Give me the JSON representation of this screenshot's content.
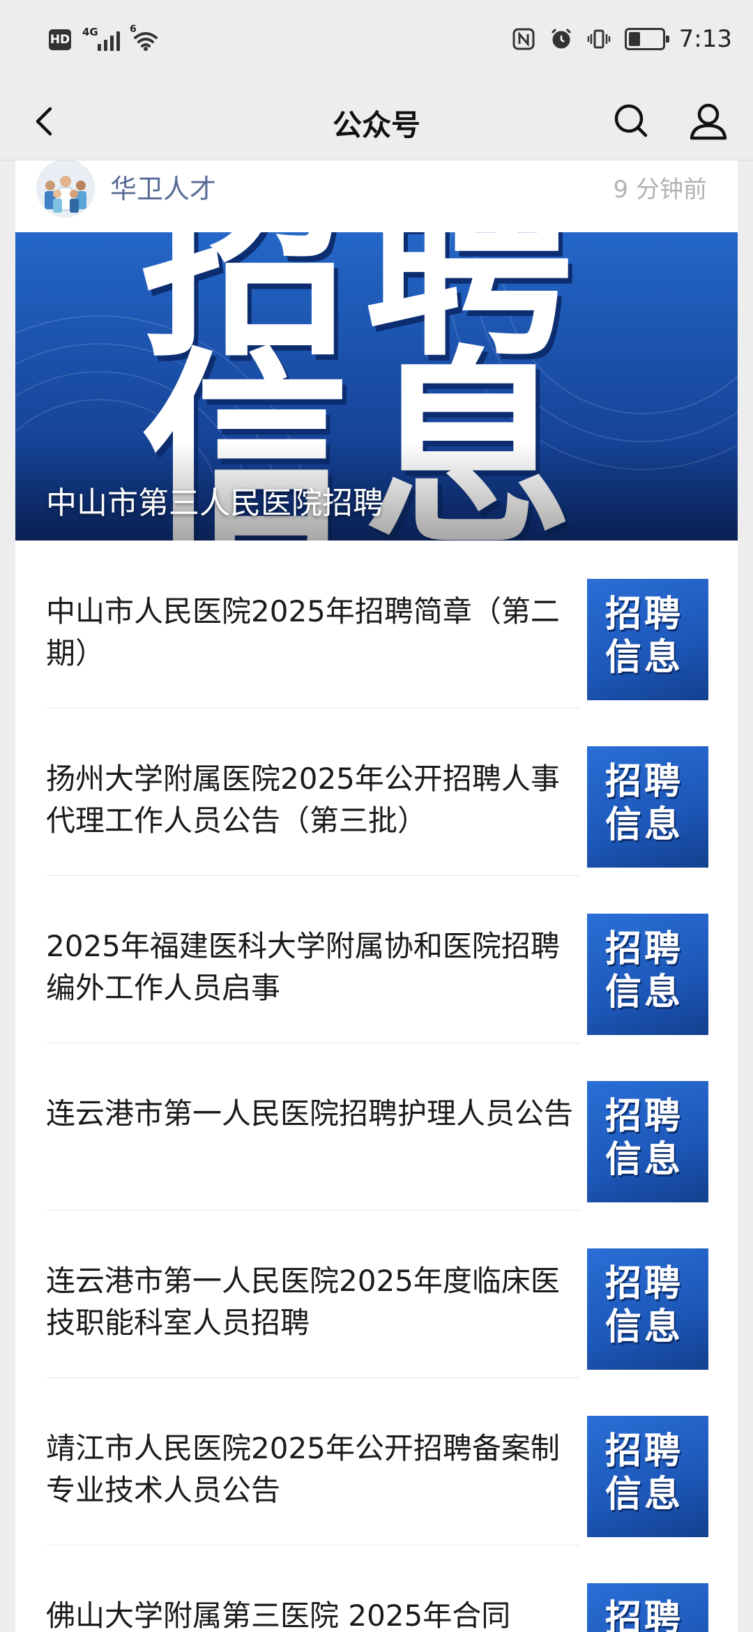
{
  "status_bar": {
    "hd": "HD",
    "network": "4G",
    "wifi_badge": "6",
    "time": "7:13",
    "battery_level": 0.35
  },
  "nav": {
    "title": "公众号",
    "back_icon": "chevron-left-icon",
    "search_icon": "search-icon",
    "profile_icon": "person-icon"
  },
  "post": {
    "account_name": "华卫人才",
    "time": "9 分钟前",
    "hero_caption": "中山市第三人民医院招聘",
    "hero_bg_text": "招聘信息"
  },
  "articles": [
    {
      "title": "中山市人民医院2025年招聘简章（第二期）",
      "thumb_text": "招聘信息"
    },
    {
      "title": "扬州大学附属医院2025年公开招聘人事代理工作人员公告（第三批）",
      "thumb_text": "招聘信息"
    },
    {
      "title": "2025年福建医科大学附属协和医院招聘编外工作人员启事",
      "thumb_text": "招聘信息"
    },
    {
      "title": "连云港市第一人民医院招聘护理人员公告",
      "thumb_text": "招聘信息"
    },
    {
      "title": "连云港市第一人民医院2025年度临床医技职能科室人员招聘",
      "thumb_text": "招聘信息"
    },
    {
      "title": "靖江市人民医院2025年公开招聘备案制专业技术人员公告",
      "thumb_text": "招聘信息"
    },
    {
      "title": "佛山大学附属第三医院 2025年合同",
      "thumb_text": "招聘信息"
    }
  ],
  "colors": {
    "link": "#576b95",
    "brand_blue": "#1d57b8",
    "background": "#ededed"
  }
}
